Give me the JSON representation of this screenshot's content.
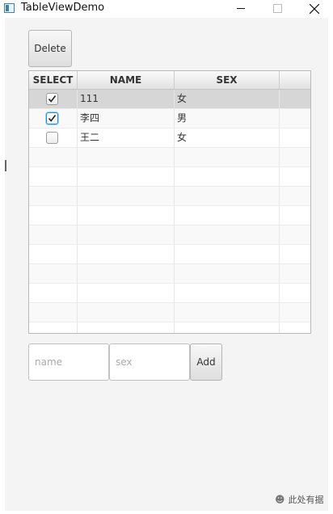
{
  "window": {
    "title": "TableViewDemo"
  },
  "toolbar": {
    "delete_label": "Delete"
  },
  "table": {
    "columns": [
      "SELECT",
      "NAME",
      "SEX",
      ""
    ],
    "rows": [
      {
        "checked": true,
        "name": "111",
        "sex": "女",
        "selected": true
      },
      {
        "checked": true,
        "name": "李四",
        "sex": "男",
        "focused": true
      },
      {
        "checked": false,
        "name": "王二",
        "sex": "女"
      }
    ],
    "empty_row_count": 10
  },
  "form": {
    "name_placeholder": "name",
    "sex_placeholder": "sex",
    "add_label": "Add"
  },
  "watermark": {
    "text": "此处有据"
  },
  "colors": {
    "focus_accent": "#1f8fd6",
    "selected_row": "#d6d6d6"
  }
}
